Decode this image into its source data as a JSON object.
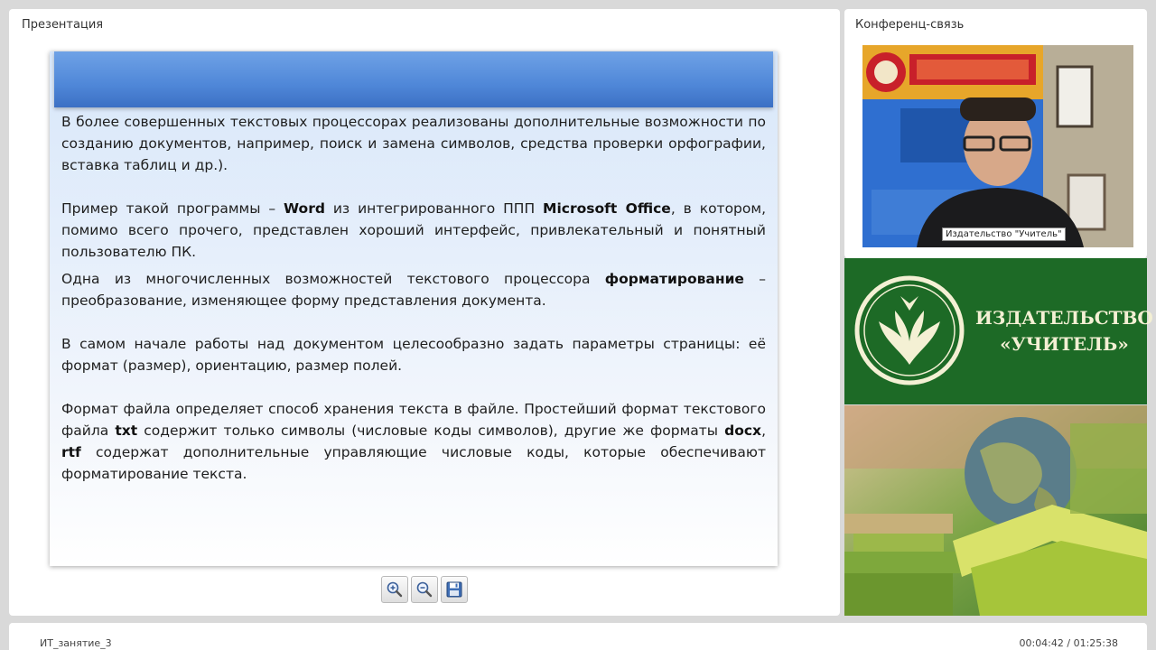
{
  "presentation": {
    "title": "Презентация",
    "slide": {
      "paragraphs": [
        [
          {
            "t": "В более совершенных текстовых процессорах реализованы дополнительные возможности по созданию документов, например, поиск и замена символов, средства проверки орфографии, вставка таблиц и др.)."
          }
        ],
        [
          {
            "t": "Пример такой программы – "
          },
          {
            "t": "Word",
            "b": true
          },
          {
            "t": " из интегрированного ППП "
          },
          {
            "t": "Microsoft Office",
            "b": true
          },
          {
            "t": ",  в котором, помимо всего прочего, представлен хороший интерфейс, привлекательный и понятный пользователю ПК."
          }
        ],
        [
          {
            "t": "Одна из многочисленных возможностей текстового процессора "
          },
          {
            "t": "форматирование",
            "b": true
          },
          {
            "t": " – преобразование, изменяющее форму представления документа."
          }
        ],
        [
          {
            "t": "В самом начале работы над документом целесообразно задать параметры страницы: её формат (размер), ориентацию, размер полей."
          }
        ],
        [
          {
            "t": "Формат файла определяет способ хранения текста в файле. Простейший формат текстового файла "
          },
          {
            "t": "txt",
            "b": true
          },
          {
            "t": " содержит только символы (числовые коды символов), другие же форматы "
          },
          {
            "t": "docx",
            "b": true
          },
          {
            "t": ", "
          },
          {
            "t": "rtf",
            "b": true
          },
          {
            "t": " содержат дополнительные управляющие числовые коды, которые обеспечивают форматирование текста."
          }
        ]
      ]
    },
    "toolbar": [
      {
        "name": "zoom-in-button",
        "icon": "zoom-in-icon"
      },
      {
        "name": "zoom-out-button",
        "icon": "zoom-out-icon"
      },
      {
        "name": "save-button",
        "icon": "floppy-disk-icon"
      }
    ]
  },
  "conference": {
    "title": "Конференц-связь",
    "video_caption": "Издательство \"Учитель\""
  },
  "brand": {
    "line1": "ИЗДАТЕЛЬСТВО",
    "line2": "«УЧИТЕЛЬ»",
    "color": "#1d6a26"
  },
  "status": {
    "lesson_title": "ИТ_занятие_3",
    "time": "00:04:42 / 01:25:38"
  }
}
